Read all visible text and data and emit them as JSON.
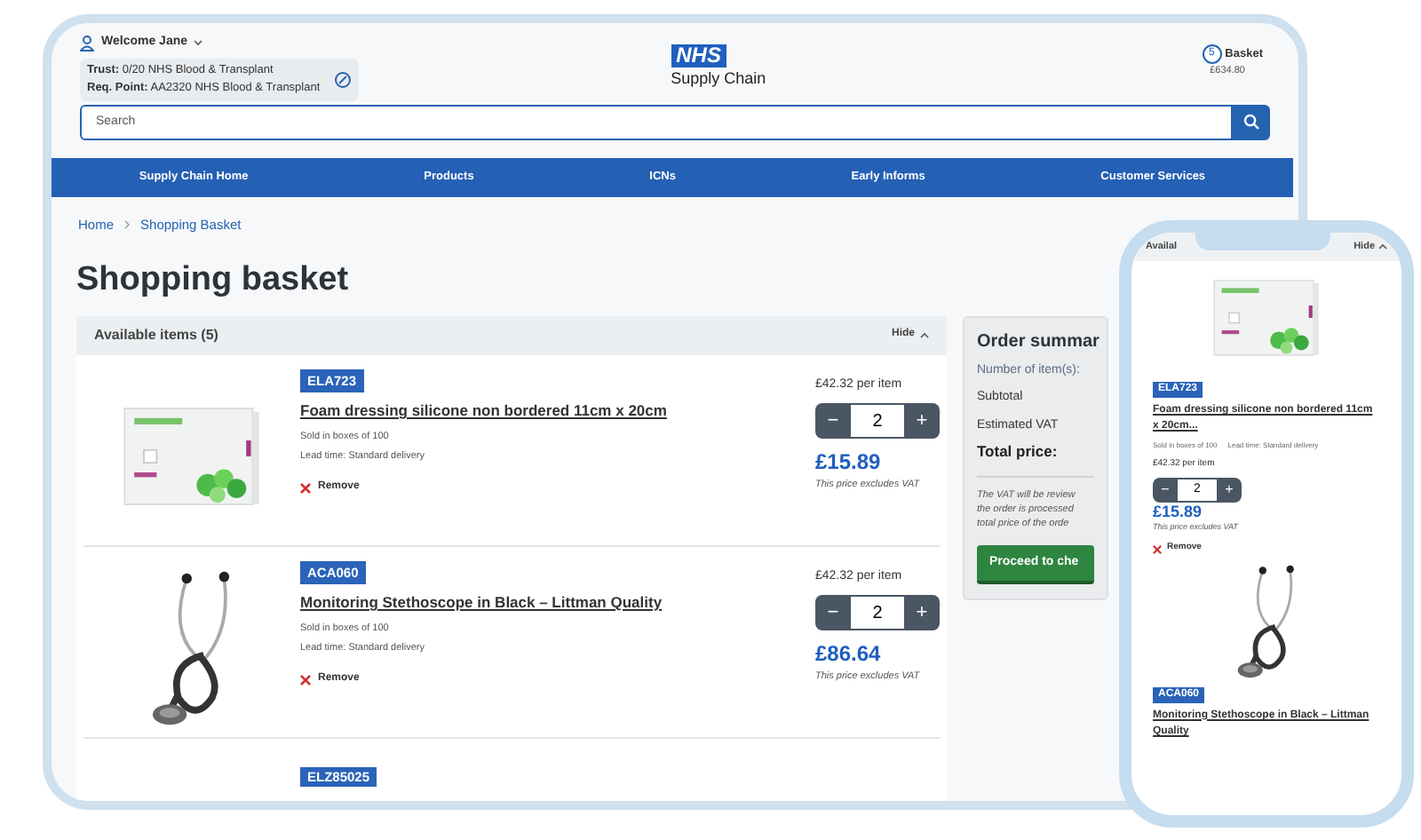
{
  "tablet": {
    "header": {
      "user": "Welcome Jane",
      "trust_label": "Trust:",
      "trust": "0/20 NHS Blood & Transplant",
      "req_label": "Req. Point:",
      "req": "AA2320 NHS Blood & Transplant",
      "logo_badge": "NHS",
      "logo_text": "Supply Chain",
      "basket_count": "5",
      "basket_label": "Basket",
      "basket_total": "£634.80"
    },
    "search": {
      "placeholder": "Search"
    },
    "nav": [
      "Supply Chain Home",
      "Products",
      "ICNs",
      "Early Informs",
      "Customer Services"
    ],
    "breadcrumbs": [
      "Home",
      "Shopping Basket"
    ],
    "title": "Shopping basket",
    "items_panel": {
      "title": "Available items (5)",
      "hide": "Hide"
    },
    "items": [
      {
        "code": "ELA723",
        "name": "Foam dressing silicone non bordered 11cm x 20cm",
        "sold": "Sold in boxes of 100",
        "lead": "Lead time: Standard delivery",
        "remove": "Remove",
        "unit_price": "£42.32 per item",
        "minus": "−",
        "qty": "2",
        "plus": "+",
        "price": "£15.89",
        "vat_note": "This price excludes VAT"
      },
      {
        "code": "ACA060",
        "name": "Monitoring Stethoscope in Black – Littman Quality",
        "sold": "Sold in boxes of 100",
        "lead": "Lead time: Standard delivery",
        "remove": "Remove",
        "unit_price": "£42.32 per item",
        "minus": "−",
        "qty": "2",
        "plus": "+",
        "price": "£86.64",
        "vat_note": "This price excludes VAT"
      }
    ],
    "next_code": "ELZ85025",
    "summary": {
      "title": "Order summar",
      "rows": [
        {
          "label": "Number of item(s):",
          "kind": "muted"
        },
        {
          "label": "Subtotal",
          "kind": "plain"
        },
        {
          "label": "Estimated VAT",
          "kind": "plain"
        },
        {
          "label": "Total price:",
          "kind": "total"
        }
      ],
      "note": [
        "The VAT will be review",
        "the order is processed",
        "total price of the orde"
      ],
      "button": "Proceed to che"
    }
  },
  "phone": {
    "panel_title": "Availal",
    "hide": "Hide",
    "items": [
      {
        "code": "ELA723",
        "name": "Foam dressing silicone non bordered 11cm x 20cm...",
        "sold": "Sold in boxes of 100",
        "lead": "Lead time: Standard delivery",
        "unit_price": "£42.32 per item",
        "minus": "−",
        "qty": "2",
        "plus": "+",
        "price": "£15.89",
        "vat_note": "This price excludes VAT",
        "remove": "Remove"
      },
      {
        "code": "ACA060",
        "name": "Monitoring Stethoscope in Black – Littman Quality"
      }
    ]
  }
}
